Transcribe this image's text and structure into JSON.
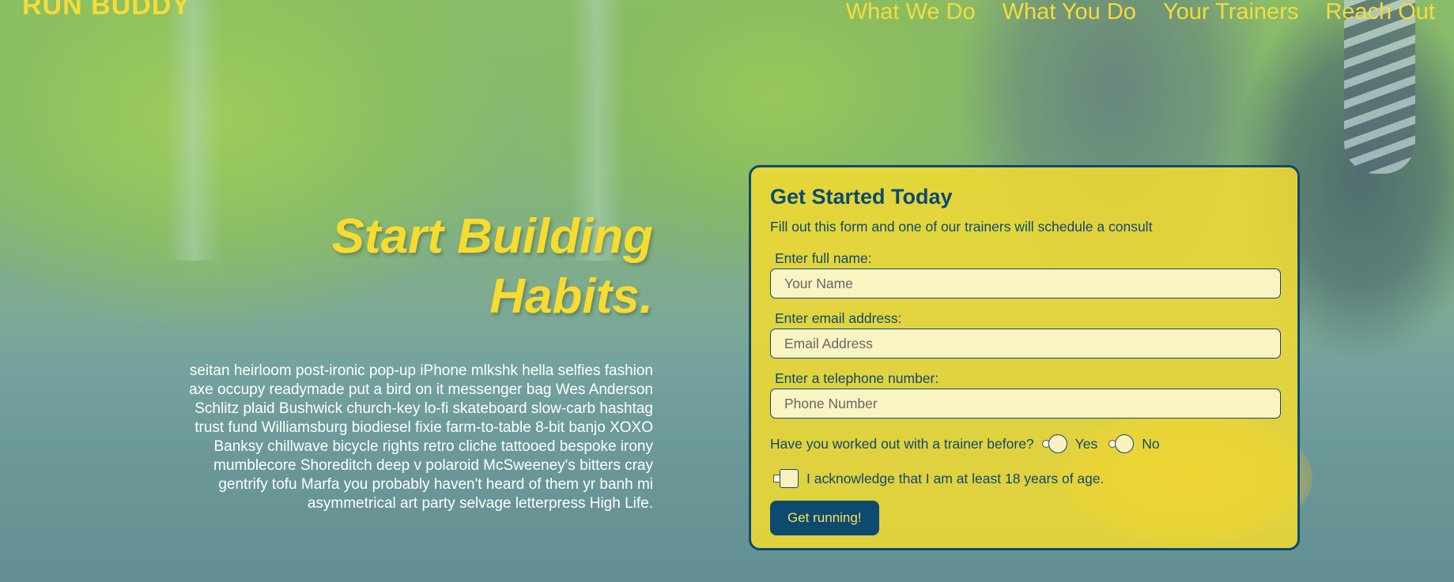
{
  "brand": {
    "logo": "RUN BUDDY"
  },
  "nav": [
    {
      "label": "What We Do"
    },
    {
      "label": "What You Do"
    },
    {
      "label": "Your Trainers"
    },
    {
      "label": "Reach Out"
    }
  ],
  "hero": {
    "title_line1": "Start Building",
    "title_line2": "Habits.",
    "body": "seitan heirloom post-ironic pop-up iPhone mlkshk hella selfies fashion axe occupy readymade put a bird on it messenger bag Wes Anderson Schlitz plaid Bushwick church-key lo-fi skateboard slow-carb hashtag trust fund Williamsburg biodiesel fixie farm-to-table 8-bit banjo XOXO Banksy chillwave bicycle rights retro cliche tattooed bespoke irony mumblecore Shoreditch deep v polaroid McSweeney's bitters cray gentrify tofu Marfa you probably haven't heard of them yr banh mi asymmetrical art party selvage letterpress High Life."
  },
  "form": {
    "title": "Get Started Today",
    "subtitle": "Fill out this form and one of our trainers will schedule a consult",
    "name_label": "Enter full name:",
    "name_placeholder": "Your Name",
    "email_label": "Enter email address:",
    "email_placeholder": "Email Address",
    "phone_label": "Enter a telephone number:",
    "phone_placeholder": "Phone Number",
    "question": "Have you worked out with a trainer before?",
    "yes_label": "Yes",
    "no_label": "No",
    "age_ack": "I acknowledge that I am at least 18 years of age.",
    "submit_label": "Get running!"
  },
  "colors": {
    "accent_yellow": "#f6dc3a",
    "brand_navy": "#0d4a70"
  }
}
